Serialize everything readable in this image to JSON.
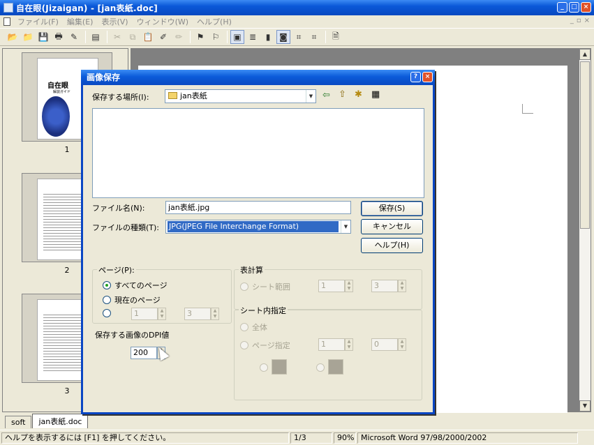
{
  "window": {
    "title": "自在眼(Jizaigan) - [jan表紙.doc]",
    "min_glyph": "_",
    "max_glyph": "□",
    "close_glyph": "×"
  },
  "menu": {
    "items": [
      "ファイル(F)",
      "編集(E)",
      "表示(V)",
      "ウィンドウ(W)",
      "ヘルプ(H)"
    ],
    "mdi_glyphs": [
      "_",
      "▫",
      "×"
    ]
  },
  "thumbnails": {
    "pages": [
      "1",
      "2",
      "3"
    ],
    "cover_title": "自在眼",
    "cover_sub": "解説ガイド"
  },
  "tabs": [
    "soft",
    "jan表紙.doc"
  ],
  "status": {
    "help": "ヘルプを表示するには [F1] を押してください。",
    "page": "1/3",
    "zoom": "90%",
    "format": "Microsoft Word 97/98/2000/2002"
  },
  "dialog": {
    "title": "画像保存",
    "help_glyph": "?",
    "close_glyph": "×",
    "location_label": "保存する場所(I):",
    "location_value": "jan表紙",
    "filename_label": "ファイル名(N):",
    "filename_value": "jan表紙.jpg",
    "filetype_label": "ファイルの種類(T):",
    "filetype_value": "JPG(JPEG File Interchange Format)",
    "save_button": "保存(S)",
    "cancel_button": "キャンセル",
    "help_button": "ヘルプ(H)",
    "page_group": {
      "title": "ページ(P):",
      "all_pages": "すべてのページ",
      "current_page": "現在のページ",
      "range_from": "1",
      "range_to": "3"
    },
    "sheet_group": {
      "title": "表計算",
      "sheet_range": "シート範囲",
      "from": "1",
      "to": "3"
    },
    "insheet_group": {
      "title": "シート内指定",
      "whole": "全体",
      "page_spec": "ページ指定",
      "from": "1",
      "to": "0"
    },
    "dpi_label": "保存する画像のDPI値",
    "dpi_value": "200"
  }
}
